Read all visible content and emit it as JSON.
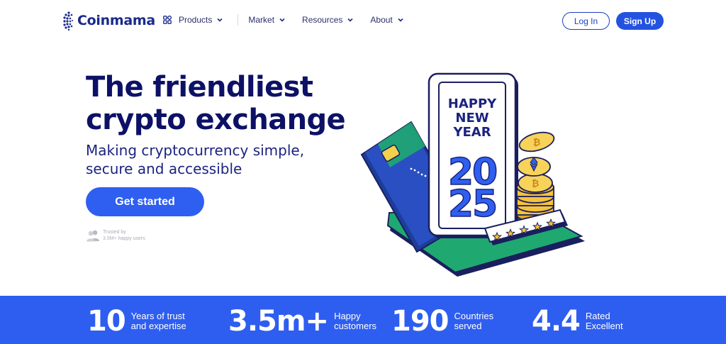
{
  "brand": {
    "name": "Coinmama",
    "primary": "#2e5ef0",
    "dark": "#0d1166"
  },
  "nav": {
    "items": [
      {
        "label": "Products",
        "icon": "grid-icon"
      },
      {
        "label": "Market"
      },
      {
        "label": "Resources"
      },
      {
        "label": "About"
      }
    ],
    "login_label": "Log In",
    "signup_label": "Sign Up"
  },
  "hero": {
    "title_line1": "The friendliest",
    "title_line2": "crypto exchange",
    "subtitle_line1": "Making cryptocurrency simple,",
    "subtitle_line2": "secure and accessible",
    "cta_label": "Get started",
    "trusted_line1": "Trusted by",
    "trusted_line2": "3.5M+ happy users"
  },
  "illustration": {
    "phone_line1": "HAPPY",
    "phone_line2": "NEW",
    "phone_line3": "YEAR",
    "year": "2025",
    "rating_stars": 5
  },
  "stats": [
    {
      "value": "10",
      "label_line1": "Years of trust",
      "label_line2": "and expertise"
    },
    {
      "value": "3.5m+",
      "label_line1": "Happy",
      "label_line2": "customers"
    },
    {
      "value": "190",
      "label_line1": "Countries",
      "label_line2": "served"
    },
    {
      "value": "4.4",
      "label_line1": "Rated",
      "label_line2": "Excellent"
    }
  ]
}
